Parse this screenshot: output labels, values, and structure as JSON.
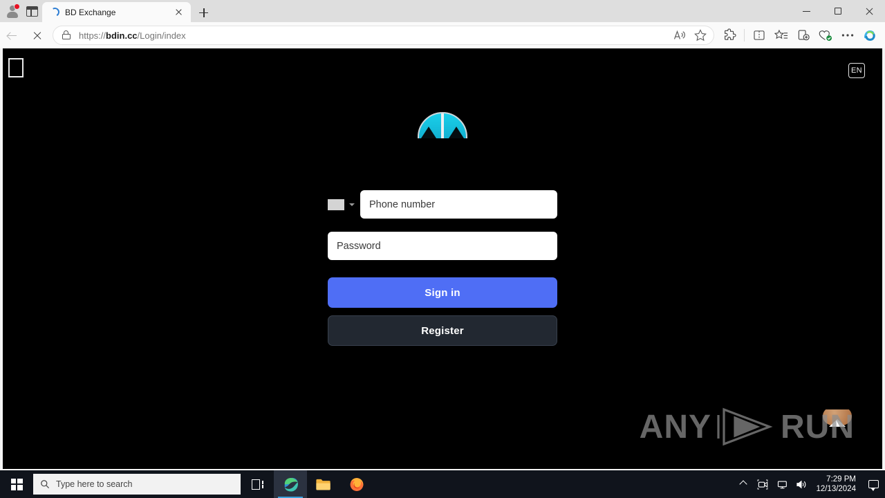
{
  "browser": {
    "window_controls": {
      "minimize": "minimize-button",
      "maximize": "maximize-restore-button",
      "close": "close-window-button"
    },
    "tab": {
      "title": "BD Exchange",
      "loading": true,
      "close_label": "×"
    },
    "new_tab_label": "+",
    "address": {
      "url_protocol": "https://",
      "url_domain": "bdin.cc",
      "url_path": "/Login/index",
      "lock": "site-information-lock"
    },
    "toolbar_icons": [
      "read-aloud-icon",
      "add-favorite-icon",
      "extensions-icon",
      "split-screen-icon",
      "collections-favorites-icon",
      "collections-icon",
      "browser-essentials-icon",
      "settings-and-more-icon",
      "copilot-icon"
    ]
  },
  "page": {
    "language_badge": "EN",
    "logo_alt": "BD Exchange logo",
    "form": {
      "country_code_selector": "country-flag-select",
      "phone_placeholder": "Phone number",
      "phone_value": "",
      "password_placeholder": "Password",
      "password_value": "",
      "sign_in_label": "Sign in",
      "register_label": "Register"
    },
    "support_widget": "customer-support-avatar",
    "watermark": {
      "left": "ANY",
      "right": "RUN"
    }
  },
  "taskbar": {
    "search_placeholder": "Type here to search",
    "apps": [
      "task-view",
      "microsoft-edge",
      "file-explorer",
      "mozilla-firefox"
    ],
    "clock": {
      "time": "7:29 PM",
      "date": "12/13/2024"
    }
  },
  "colors": {
    "page_bg": "#000000",
    "accent_blue": "#4f6ef5",
    "register_bg": "#222831",
    "logo_cyan": "#1ad0ea",
    "taskbar_bg": "#10141c"
  }
}
